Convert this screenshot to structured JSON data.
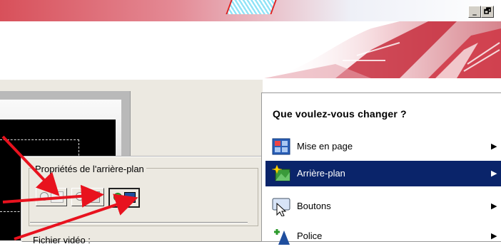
{
  "window": {
    "controls": {
      "minimize": "_",
      "restore": "🗗"
    }
  },
  "properties_panel": {
    "group_label": "Propriétés de l'arrière-plan",
    "partial_label": "Fichier vidéo :"
  },
  "menu": {
    "title": "Que voulez-vous changer ?",
    "items": [
      {
        "label": "Mise en page",
        "icon": "layout-icon",
        "selected": false
      },
      {
        "label": "Arrière-plan",
        "icon": "background-icon",
        "selected": true
      },
      {
        "label": "Boutons",
        "icon": "buttons-icon",
        "selected": false
      },
      {
        "label": "Police",
        "icon": "font-icon",
        "selected": false
      }
    ]
  },
  "colors": {
    "selection": "#0a246a",
    "annotation_arrow": "#e8121e",
    "panel": "#ece9e1"
  }
}
